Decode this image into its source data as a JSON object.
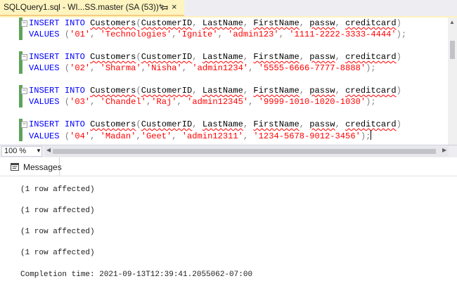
{
  "tab": {
    "title": "SQLQuery1.sql - WI...SS.master (SA (53))*",
    "pin_icon": "pin-icon",
    "close_icon": "close-icon",
    "close_glyph": "×"
  },
  "editor": {
    "statements": [
      {
        "insert_kw": "INSERT",
        "into_kw": "INTO",
        "table": "Customers",
        "columns": [
          "CustomerID",
          "LastName",
          "FirstName",
          "passw",
          "creditcard"
        ],
        "values_kw": "VALUES",
        "values": [
          "'01'",
          "'Technologies'",
          "'Ignite'",
          "'admin123'",
          "'1111-2222-3333-4444'"
        ]
      },
      {
        "insert_kw": "INSERT",
        "into_kw": "INTO",
        "table": "Customers",
        "columns": [
          "CustomerID",
          "LastName",
          "FirstName",
          "passw",
          "creditcard"
        ],
        "values_kw": "VALUES",
        "values": [
          "'02'",
          "'Sharma'",
          "'Nisha'",
          "'admin1234'",
          "'5555-6666-7777-8888'"
        ]
      },
      {
        "insert_kw": "INSERT",
        "into_kw": "INTO",
        "table": "Customers",
        "columns": [
          "CustomerID",
          "LastName",
          "FirstName",
          "passw",
          "creditcard"
        ],
        "values_kw": "VALUES",
        "values": [
          "'03'",
          "'Chandel'",
          "'Raj'",
          "'admin12345'",
          "'9999-1010-1020-1030'"
        ]
      },
      {
        "insert_kw": "INSERT",
        "into_kw": "INTO",
        "table": "Customers",
        "columns": [
          "CustomerID",
          "LastName",
          "FirstName",
          "passw",
          "creditcard"
        ],
        "values_kw": "VALUES",
        "values": [
          "'04'",
          "'Madan'",
          "'Geet'",
          "'admin12311'",
          "'1234-5678-9012-3456'"
        ]
      }
    ],
    "colors": {
      "keyword": "#0000ff",
      "string": "#ff0000",
      "punctuation": "#808080",
      "change_bar": "#5ea35c"
    }
  },
  "zoom": {
    "value": "100 %",
    "dropdown_icon": "chevron-down-icon"
  },
  "results": {
    "tab_label": "Messages",
    "tab_icon": "messages-icon",
    "lines": [
      "(1 row affected)",
      "(1 row affected)",
      "(1 row affected)",
      "(1 row affected)",
      "Completion time: 2021-09-13T12:39:41.2055062-07:00"
    ]
  }
}
